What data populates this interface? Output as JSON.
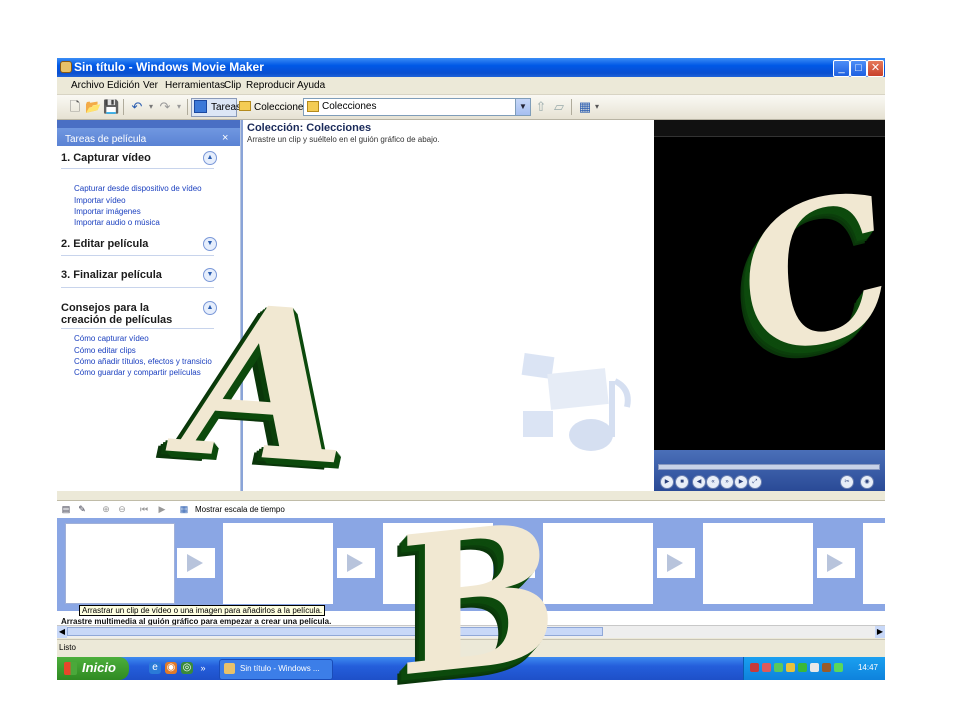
{
  "window": {
    "title": "Sin título - Windows Movie Maker",
    "controls": {
      "minimize": "_",
      "maximize": "□",
      "close": "✕"
    }
  },
  "menubar": [
    "Archivo",
    "Edición",
    "Ver",
    "Herramientas",
    "Clip",
    "Reproducir",
    "Ayuda"
  ],
  "toolbar": {
    "tareas_label": "Tareas",
    "colecciones_label": "Colecciones",
    "combo_value": "Colecciones"
  },
  "task_pane": {
    "header": "Tareas de película",
    "close": "×",
    "sections": [
      {
        "title": "1. Capturar vídeo",
        "state": "expanded",
        "links": [
          "Capturar desde dispositivo de vídeo",
          "Importar vídeo",
          "Importar imágenes",
          "Importar audio o música"
        ]
      },
      {
        "title": "2. Editar película",
        "state": "collapsed",
        "links": []
      },
      {
        "title": "3. Finalizar película",
        "state": "collapsed",
        "links": []
      },
      {
        "title": "Consejos para la creación de películas",
        "state": "expanded",
        "links": [
          "Cómo capturar vídeo",
          "Cómo editar clips",
          "Cómo añadir títulos, efectos y transicio",
          "Cómo guardar y compartir películas"
        ]
      }
    ]
  },
  "collection": {
    "title": "Colección: Colecciones",
    "subtitle": "Arrastre un clip y suéltelo en el guión gráfico de abajo."
  },
  "storyboard": {
    "show_timeline_label": "Mostrar escala de tiempo",
    "tooltip": "Arrastrar un clip de vídeo o una imagen para añadirlos a la película.",
    "hint": "Arrastre multimedia al guión gráfico para empezar a crear una película."
  },
  "status": "Listo",
  "taskbar": {
    "start_label": "Inicio",
    "task_label": "Sin título - Windows ...",
    "clock": "14:47"
  },
  "overlay_letters": [
    "A",
    "B",
    "C"
  ],
  "colors": {
    "xp_blue": "#245edb",
    "letter_face": "#f1e8d2",
    "letter_side": "#0d4a0d",
    "storyboard_bg": "#8aa6e4"
  }
}
